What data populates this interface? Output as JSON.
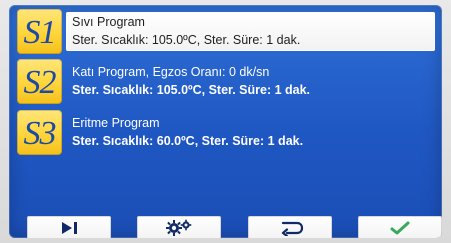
{
  "programs": [
    {
      "slot_label": "S1",
      "selected": true,
      "line1": "Sıvı Program",
      "line2": "Ster. Sıcaklık: 105.0ºC, Ster. Süre: 1 dak."
    },
    {
      "slot_label": "S2",
      "selected": false,
      "line1": "Katı Program, Egzos Oranı: 0 dk/sn",
      "line2": "Ster. Sıcaklık: 105.0ºC, Ster. Süre: 1 dak."
    },
    {
      "slot_label": "S3",
      "selected": false,
      "line1": "Eritme Program",
      "line2": "Ster. Sıcaklık: 60.0ºC, Ster. Süre: 1 dak."
    }
  ],
  "toolbar": {
    "buttons": [
      {
        "icon": "play-skip-icon"
      },
      {
        "icon": "gears-icon"
      },
      {
        "icon": "return-icon"
      },
      {
        "icon": "check-icon"
      }
    ]
  },
  "colors": {
    "screen_top": "#2f6fd6",
    "screen_bottom": "#1b4eb6",
    "slot_yellow": "#ffd53a",
    "slot_text_blue": "#1d4aa6",
    "selected_bg": "#ffffff",
    "text_white": "#ffffff",
    "text_dark": "#1e1e1e",
    "icon_dark_blue": "#0f2a66",
    "check_green": "#3aa85a"
  }
}
